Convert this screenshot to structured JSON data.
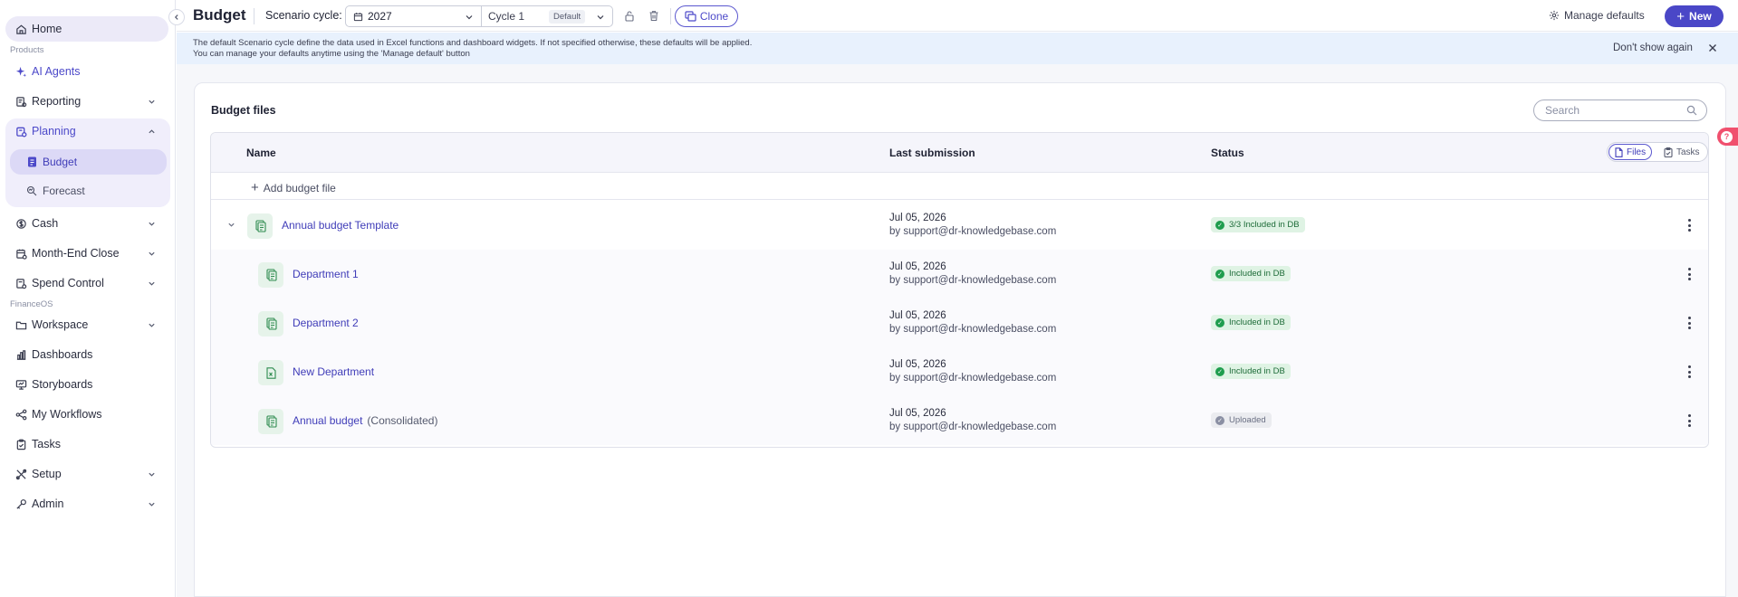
{
  "sidebar": {
    "home": "Home",
    "section_products": "Products",
    "ai_agents": "AI Agents",
    "reporting": "Reporting",
    "planning": "Planning",
    "budget": "Budget",
    "forecast": "Forecast",
    "cash": "Cash",
    "month_end_close": "Month-End Close",
    "spend_control": "Spend Control",
    "section_financeos": "FinanceOS",
    "workspace": "Workspace",
    "dashboards": "Dashboards",
    "storyboards": "Storyboards",
    "my_workflows": "My Workflows",
    "tasks": "Tasks",
    "setup": "Setup",
    "admin": "Admin"
  },
  "topbar": {
    "title": "Budget",
    "scenario_label": "Scenario cycle:",
    "year": "2027",
    "cycle": "Cycle 1",
    "default_tag": "Default",
    "clone": "Clone",
    "manage_defaults": "Manage defaults",
    "new": "New"
  },
  "banner": {
    "line1": "The default Scenario cycle define the data used in Excel functions and dashboard widgets. If not specified otherwise, these defaults will be applied.",
    "line2": "You can manage your defaults anytime using the 'Manage default' button",
    "dont_show": "Don't show again"
  },
  "card": {
    "title": "Budget files",
    "search_placeholder": "Search"
  },
  "table": {
    "col_name": "Name",
    "col_submission": "Last submission",
    "col_status": "Status",
    "toggle_files": "Files",
    "toggle_tasks": "Tasks",
    "add_file": "Add budget file",
    "rows": [
      {
        "name": "Annual budget Template",
        "suffix": "",
        "date": "Jul 05, 2026",
        "by": "by support@dr-knowledgebase.com",
        "status": "3/3 Included in DB"
      },
      {
        "name": "Department 1",
        "suffix": "",
        "date": "Jul 05, 2026",
        "by": "by support@dr-knowledgebase.com",
        "status": "Included in DB"
      },
      {
        "name": "Department 2",
        "suffix": "",
        "date": "Jul 05, 2026",
        "by": "by support@dr-knowledgebase.com",
        "status": "Included in DB"
      },
      {
        "name": "New Department",
        "suffix": "",
        "date": "Jul 05, 2026",
        "by": "by support@dr-knowledgebase.com",
        "status": "Included in DB"
      },
      {
        "name": "Annual budget",
        "suffix": "(Consolidated)",
        "date": "Jul 05, 2026",
        "by": "by support@dr-knowledgebase.com",
        "status": "Uploaded"
      }
    ]
  },
  "colors": {
    "accent": "#4a47c7",
    "status_green": "#1f9d4e",
    "status_grey": "#8a8fa3",
    "banner_bg": "#e8f1fd",
    "help_pink": "#f0506e"
  }
}
